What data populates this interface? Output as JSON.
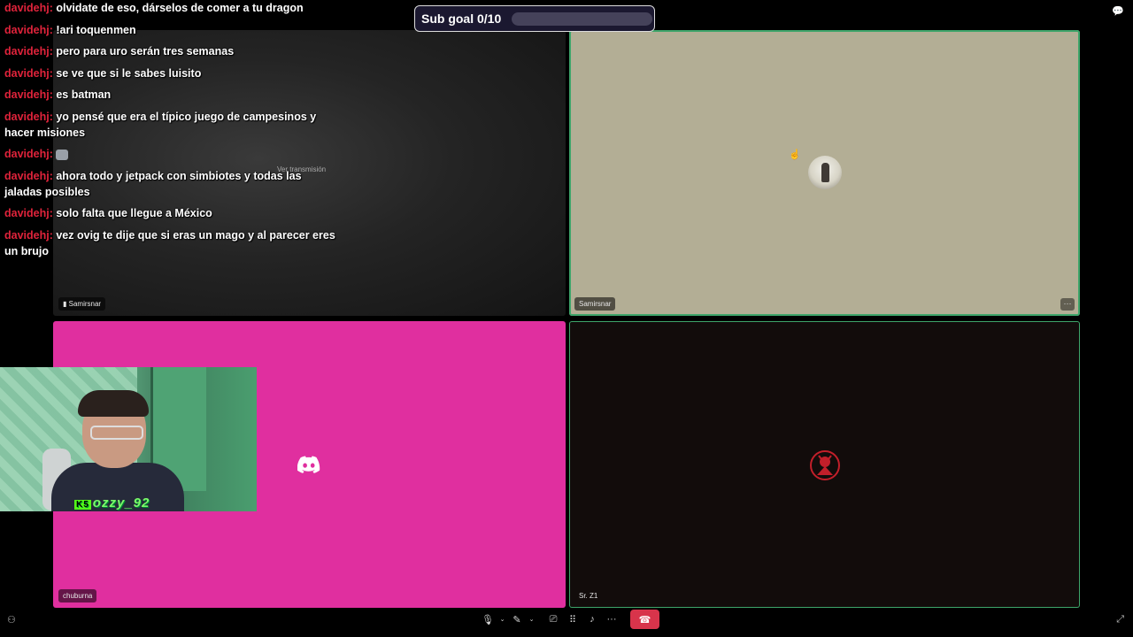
{
  "chat": {
    "messages": [
      {
        "user": "davidehj:",
        "text": "olvidate de eso, dárselos de comer a tu dragon"
      },
      {
        "user": "davidehj:",
        "text": "!ari toquenmen"
      },
      {
        "user": "davidehj:",
        "text": "pero para uro serán tres semanas"
      },
      {
        "user": "davidehj:",
        "text": "se ve que si le sabes luisito"
      },
      {
        "user": "davidehj:",
        "text": "es batman"
      },
      {
        "user": "davidehj:",
        "text": "yo pensé que era el típico juego de campesinos y hacer misiones"
      },
      {
        "user": "davidehj:",
        "text": ""
      },
      {
        "user": "davidehj:",
        "text": "ahora todo y jetpack con simbiotes y todas las jaladas posibles"
      },
      {
        "user": "davidehj:",
        "text": "solo falta que llegue a México"
      },
      {
        "user": "davidehj:",
        "text": "vez ovig te dije que si eras un mago y al parecer eres un brujo"
      }
    ]
  },
  "sub_goal": {
    "label": "Sub goal 0/10",
    "progress": 0.0
  },
  "tiles": {
    "top_left": {
      "name": "Samirsnar",
      "overlay_text": "Ver transmisión"
    },
    "top_right": {
      "name": "Samirsnar",
      "more": "···"
    },
    "bottom_left": {
      "name": "chuburna"
    },
    "bottom_right": {
      "name": "Sr. Z1"
    }
  },
  "webcam": {
    "badge": "K",
    "badge_num": "5",
    "username": "ozzy_92"
  },
  "toolbar": {
    "mic": "🎙",
    "cam": "✎",
    "chev": "⌄",
    "share": "⎚",
    "activities": "⠿",
    "soundboard": "♪",
    "more": "···",
    "hangup": "☎"
  },
  "icons": {
    "chat_icon": "💬",
    "people_icon": "⚇",
    "fullscreen_icon": "⤢",
    "cursor_icon": "☝",
    "emote_icon": "cat-emote"
  },
  "colors": {
    "username": "#e0233b",
    "discord_pink": "#e02f9f",
    "speaking_green": "#3ea56a",
    "hangup_red": "#d8344b"
  }
}
